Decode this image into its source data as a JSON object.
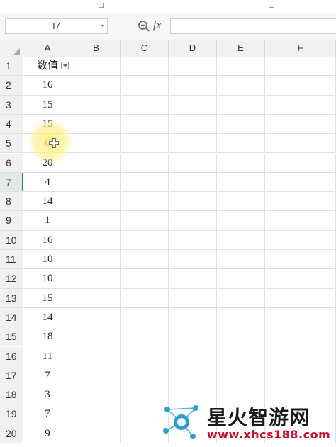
{
  "formula_bar": {
    "cell_reference": "I7",
    "formula_value": ""
  },
  "columns": [
    "A",
    "B",
    "C",
    "D",
    "E",
    "F"
  ],
  "rows": [
    {
      "num": "1",
      "a": "数值"
    },
    {
      "num": "2",
      "a": "16"
    },
    {
      "num": "3",
      "a": "15"
    },
    {
      "num": "4",
      "a": "15"
    },
    {
      "num": "5",
      "a": "6"
    },
    {
      "num": "6",
      "a": "20"
    },
    {
      "num": "7",
      "a": "4"
    },
    {
      "num": "8",
      "a": "14"
    },
    {
      "num": "9",
      "a": "1"
    },
    {
      "num": "10",
      "a": "16"
    },
    {
      "num": "11",
      "a": "10"
    },
    {
      "num": "12",
      "a": "10"
    },
    {
      "num": "13",
      "a": "15"
    },
    {
      "num": "14",
      "a": "14"
    },
    {
      "num": "15",
      "a": "18"
    },
    {
      "num": "16",
      "a": "11"
    },
    {
      "num": "17",
      "a": "7"
    },
    {
      "num": "18",
      "a": "3"
    },
    {
      "num": "19",
      "a": "7"
    },
    {
      "num": "20",
      "a": "9"
    }
  ],
  "active_row": "7",
  "watermark": {
    "title": "星火智游网",
    "url": "www.xhcs188.com"
  }
}
